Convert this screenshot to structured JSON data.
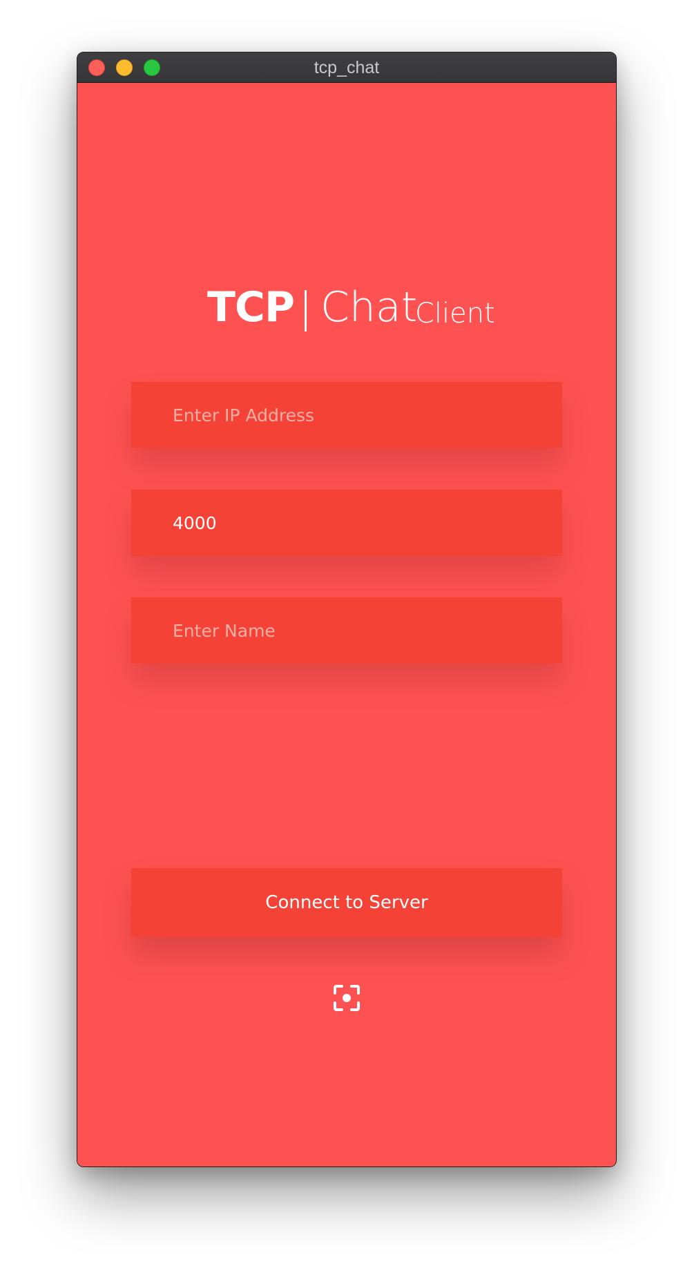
{
  "window": {
    "title": "tcp_chat"
  },
  "logo": {
    "tcp": "TCP",
    "chat": "Chat",
    "client": "Client"
  },
  "form": {
    "ip": {
      "value": "",
      "placeholder": "Enter IP Address"
    },
    "port": {
      "value": "4000",
      "placeholder": ""
    },
    "name": {
      "value": "",
      "placeholder": "Enter Name"
    }
  },
  "connect_button": {
    "label": "Connect to Server"
  },
  "icons": {
    "bottom": "screenshot-icon"
  },
  "colors": {
    "background": "#fe5252",
    "field": "#f44237",
    "text": "#ffffff",
    "placeholder": "#fbb0a7"
  }
}
